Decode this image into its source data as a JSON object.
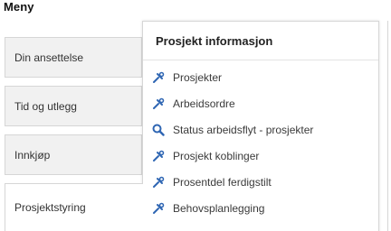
{
  "menu": {
    "title": "Meny"
  },
  "nav": {
    "items": [
      {
        "label": "Din ansettelse"
      },
      {
        "label": "Tid og utlegg"
      },
      {
        "label": "Innkjøp"
      },
      {
        "label": "Prosjektstyring"
      }
    ]
  },
  "panel": {
    "title": "Prosjekt informasjon",
    "items": [
      {
        "label": "Prosjekter",
        "icon": "tool-icon"
      },
      {
        "label": "Arbeidsordre",
        "icon": "tool-icon"
      },
      {
        "label": "Status arbeidsflyt - prosjekter",
        "icon": "search-icon"
      },
      {
        "label": "Prosjekt koblinger",
        "icon": "tool-icon"
      },
      {
        "label": "Prosentdel ferdigstilt",
        "icon": "tool-icon"
      },
      {
        "label": "Behovsplanlegging",
        "icon": "tool-icon"
      }
    ]
  },
  "colors": {
    "icon": "#2f66b3",
    "tab_bg": "#f1f1f1",
    "border": "#d6d6d6"
  }
}
